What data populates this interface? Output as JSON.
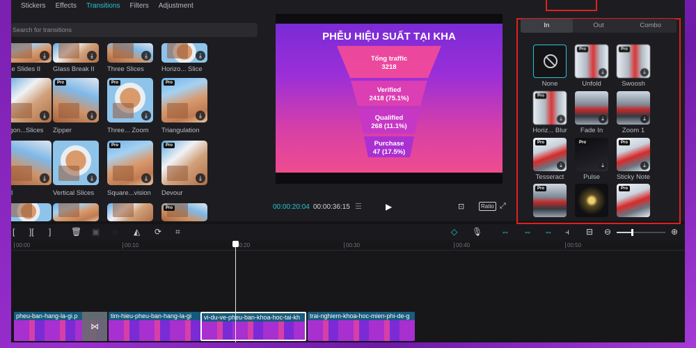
{
  "top_tabs": [
    "Stickers",
    "Effects",
    "Transitions",
    "Filters",
    "Adjustment"
  ],
  "transitions": {
    "search_placeholder": "Search for transitions",
    "items": [
      {
        "label": "ree Slides II",
        "pro": false
      },
      {
        "label": "Glass Break II",
        "pro": false
      },
      {
        "label": "Three Slices",
        "pro": false
      },
      {
        "label": "Horizo... Slice",
        "pro": false
      },
      {
        "label": "agon...Slices",
        "pro": false
      },
      {
        "label": "Zipper",
        "pro": true
      },
      {
        "label": "Three... Zoom",
        "pro": true
      },
      {
        "label": "Triangulation",
        "pro": true
      },
      {
        "label": "t II",
        "pro": false
      },
      {
        "label": "Vertical Slices",
        "pro": false
      },
      {
        "label": "Square...vision",
        "pro": true
      },
      {
        "label": "Devour",
        "pro": true
      },
      {
        "label": "",
        "pro": false
      },
      {
        "label": "",
        "pro": false
      },
      {
        "label": "",
        "pro": false
      },
      {
        "label": "",
        "pro": true
      }
    ]
  },
  "preview": {
    "slide_title": "PHỄU HIỆU SUẤT TẠI KHA",
    "time_current": "00:00:20:04",
    "time_total": "00:00:36:15",
    "ratio_label": "Ratio",
    "chart_data": {
      "type": "funnel",
      "title": "PHỄU HIỆU SUẤT TẠI KHA",
      "stages": [
        {
          "name": "Tổng traffic",
          "value": 3218,
          "label": "3218"
        },
        {
          "name": "Verified",
          "value": 2418,
          "label": "2418 (75.1%)"
        },
        {
          "name": "Qualified",
          "value": 268,
          "label": "268 (11.1%)"
        },
        {
          "name": "Purchase",
          "value": 47,
          "label": "47 (17.5%)"
        }
      ],
      "colors": [
        "#f04a9a",
        "#de3fb2",
        "#c637c6",
        "#a72fd4"
      ]
    }
  },
  "animation": {
    "tabs": [
      "In",
      "Out",
      "Combo"
    ],
    "active_tab": "In",
    "items": [
      {
        "label": "None",
        "pro": false,
        "style": "none"
      },
      {
        "label": "Unfold",
        "pro": true,
        "style": "blur"
      },
      {
        "label": "Swoosh",
        "pro": true,
        "style": "blur"
      },
      {
        "label": "Horiz... Blur",
        "pro": true,
        "style": "blur"
      },
      {
        "label": "Fade In",
        "pro": false,
        "style": "ropeway"
      },
      {
        "label": "Zoom 1",
        "pro": false,
        "style": "ropeway"
      },
      {
        "label": "Tesseract",
        "pro": true,
        "style": "default"
      },
      {
        "label": "Pulse",
        "pro": true,
        "style": "dark"
      },
      {
        "label": "Sticky Note",
        "pro": true,
        "style": "default"
      },
      {
        "label": "",
        "pro": true,
        "style": "ropeway"
      },
      {
        "label": "",
        "pro": false,
        "style": "glow"
      },
      {
        "label": "",
        "pro": true,
        "style": "default"
      }
    ]
  },
  "timeline": {
    "ruler_ticks": [
      "00:00",
      "00:10",
      "00:20",
      "00:30",
      "00:40",
      "00:50"
    ],
    "clips": [
      {
        "name": "pheu-ban-hang-la-gi.p",
        "selected": false
      },
      {
        "name": "tim-hieu-pheu-ban-hang-la-gi",
        "selected": false
      },
      {
        "name": "vi-du-ve-pheu-ban-khoa-hoc-tai-kh",
        "selected": true
      },
      {
        "name": "trai-nghiem-khoa-hoc-mien-phi-de-g",
        "selected": false
      }
    ],
    "zoom_fraction": 0.3
  }
}
